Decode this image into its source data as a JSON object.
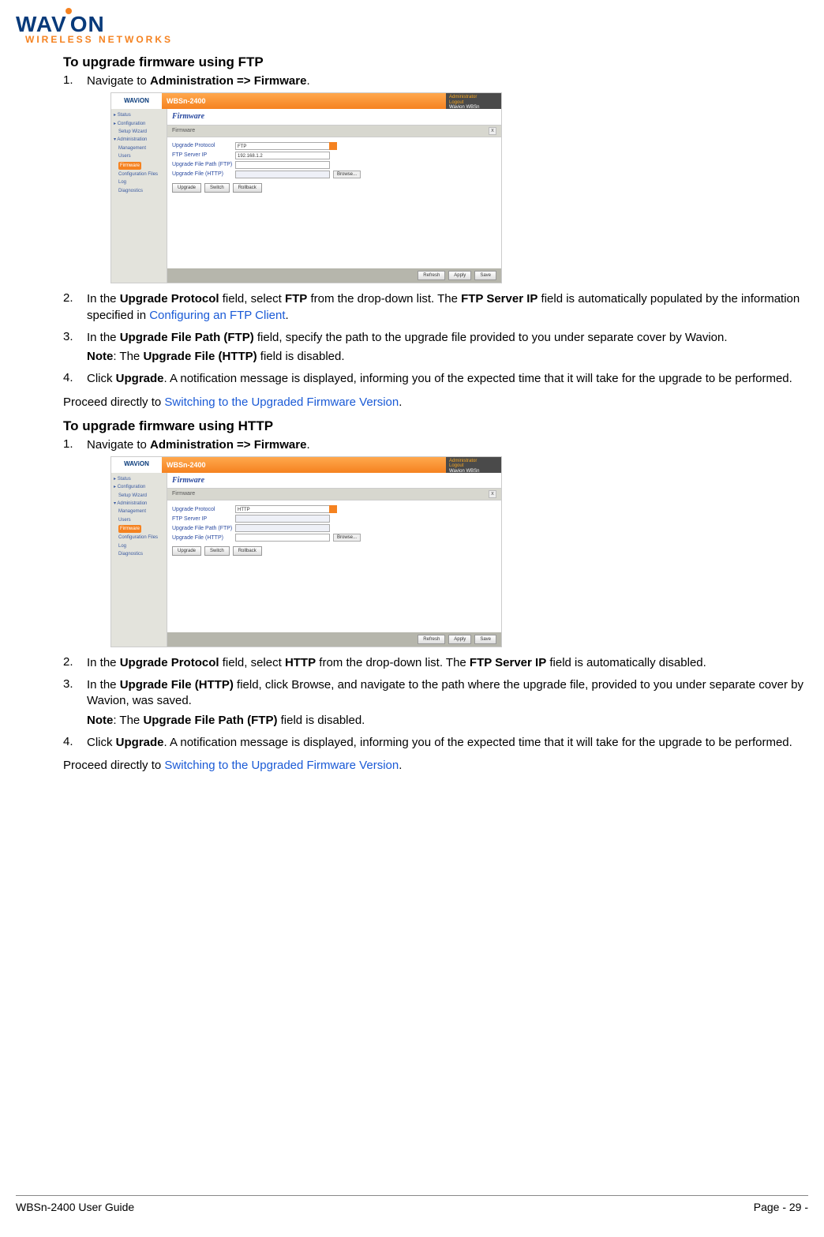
{
  "logo": {
    "brand_left": "WAV",
    "brand_right": "ON",
    "tagline": "WIRELESS NETWORKS"
  },
  "ftp": {
    "heading": "To upgrade firmware using FTP",
    "step1_num": "1.",
    "step1_a": "Navigate to ",
    "step1_b": "Administration => Firmware",
    "step1_c": ".",
    "step2_num": "2.",
    "step2_a": "In the ",
    "step2_b": "Upgrade Protocol",
    "step2_c": " field, select ",
    "step2_d": "FTP",
    "step2_e": " from the drop-down list. The ",
    "step2_f": "FTP Server IP",
    "step2_g": " field is automatically populated by the information specified in ",
    "step2_link": "Configuring an FTP Client",
    "step2_h": ".",
    "step3_num": "3.",
    "step3_a": "In the ",
    "step3_b": "Upgrade File Path (FTP)",
    "step3_c": " field, specify the path to the upgrade file provided to you under separate cover by Wavion.",
    "step3_note_a": "Note",
    "step3_note_b": ": The ",
    "step3_note_c": "Upgrade File (HTTP)",
    "step3_note_d": " field is disabled.",
    "step4_num": "4.",
    "step4_a": "Click ",
    "step4_b": "Upgrade",
    "step4_c": ". A notification message is displayed, informing you of the expected time that it will take for the upgrade to be performed.",
    "after_a": "Proceed directly to ",
    "after_link": "Switching to the Upgraded Firmware Version",
    "after_b": "."
  },
  "http": {
    "heading": "To upgrade firmware using HTTP",
    "step1_num": "1.",
    "step1_a": "Navigate to ",
    "step1_b": "Administration => Firmware",
    "step1_c": ".",
    "step2_num": "2.",
    "step2_a": "In the ",
    "step2_b": "Upgrade Protocol",
    "step2_c": " field, select ",
    "step2_d": "HTTP",
    "step2_e": " from the drop-down list. The ",
    "step2_f": "FTP Server IP",
    "step2_g": " field is automatically disabled.",
    "step3_num": "3.",
    "step3_a": "In the ",
    "step3_b": "Upgrade File (HTTP)",
    "step3_c": " field, click Browse, and navigate to the path where the upgrade file, provided to you under separate cover by Wavion, was saved.",
    "step3_note_a": "Note",
    "step3_note_b": ": The ",
    "step3_note_c": "Upgrade File Path (FTP)",
    "step3_note_d": " field is disabled.",
    "step4_num": "4.",
    "step4_a": "Click ",
    "step4_b": "Upgrade",
    "step4_c": ". A notification message is displayed, informing you of the expected time that it will take for the upgrade to be performed.",
    "after_a": "Proceed directly to ",
    "after_link": "Switching to the Upgraded Firmware Version",
    "after_b": "."
  },
  "screenshot": {
    "logo": "WAViON",
    "device": "WBSn-2400",
    "admin1": "Administrator",
    "admin2": "Logout",
    "admin3": "Wavion WBSn",
    "nav": {
      "status": "Status",
      "configuration": "Configuration",
      "setup_wizard": "Setup Wizard",
      "administration": "Administration",
      "management": "Management",
      "users": "Users",
      "firmware": "Firmware",
      "config_files": "Configuration Files",
      "log": "Log",
      "diagnostics": "Diagnostics"
    },
    "crumb": "Firmware",
    "panel_head": "Firmware",
    "corner": "x",
    "labels": {
      "proto": "Upgrade Protocol",
      "ip": "FTP Server IP",
      "path_ftp": "Upgrade File Path (FTP)",
      "file_http": "Upgrade File (HTTP)"
    },
    "values": {
      "proto_ftp": "FTP",
      "proto_http": "HTTP",
      "ip": "192.168.1.2"
    },
    "buttons": {
      "browse": "Browse...",
      "upgrade": "Upgrade",
      "switch": "Switch",
      "rollback": "Rollback",
      "refresh": "Refresh",
      "apply": "Apply",
      "save": "Save"
    }
  },
  "footer": {
    "left": "WBSn-2400 User Guide",
    "right": "Page - 29 -"
  }
}
